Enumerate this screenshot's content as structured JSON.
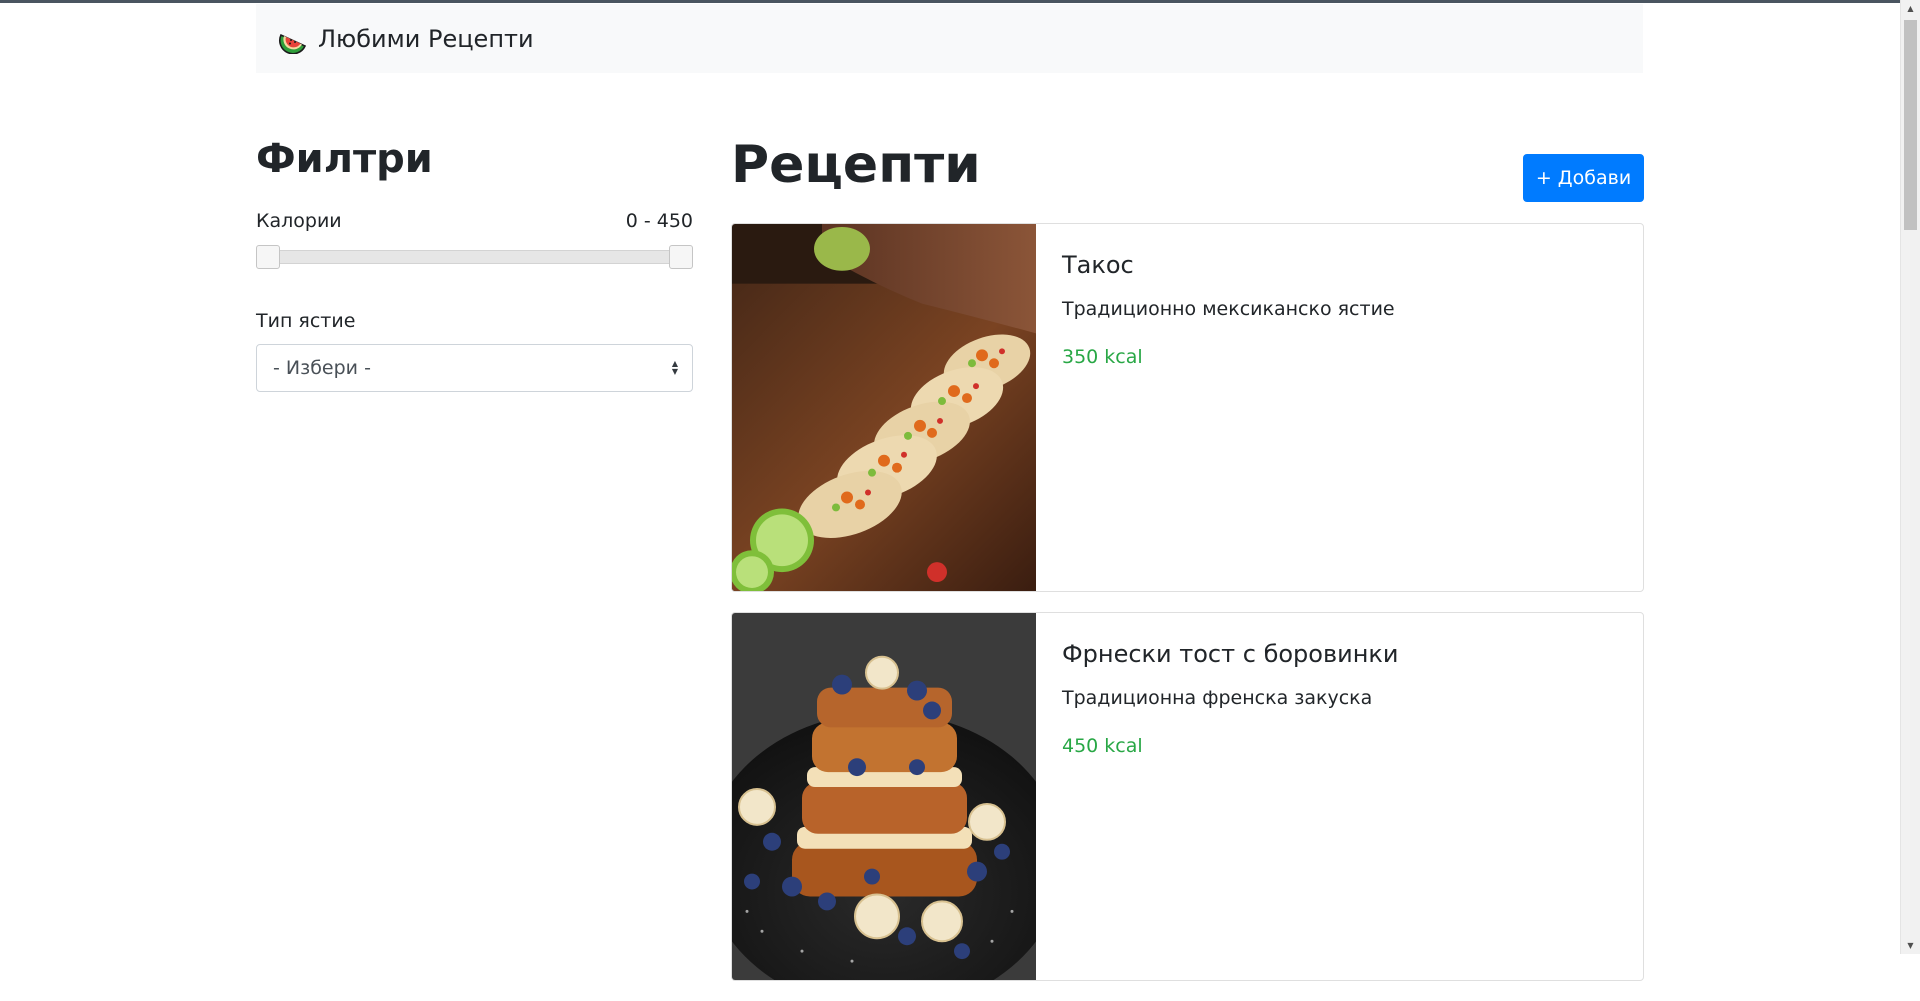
{
  "navbar": {
    "brand_icon": "watermelon-icon",
    "brand_name": "Любими Рецепти"
  },
  "sidebar": {
    "title": "Филтри",
    "calories_label": "Калории",
    "calories_range": "0 - 450",
    "calories_min": 0,
    "calories_max": 450,
    "meal_type_label": "Тип ястие",
    "meal_type_value": "- Избери -"
  },
  "main": {
    "title": "Рецепти",
    "add_button_label": "+ Добави",
    "recipes": [
      {
        "title": "Такос",
        "description": "Традиционно мексиканско ястие",
        "calories": "350 kcal",
        "image": "tacos-photo"
      },
      {
        "title": "Фрнески тост с боровинки",
        "description": "Традиционна френска закуска",
        "calories": "450 kcal",
        "image": "french-toast-photo"
      }
    ]
  },
  "colors": {
    "primary": "#007bff",
    "success": "#28a745",
    "navbar_bg": "#f8f9fa"
  }
}
